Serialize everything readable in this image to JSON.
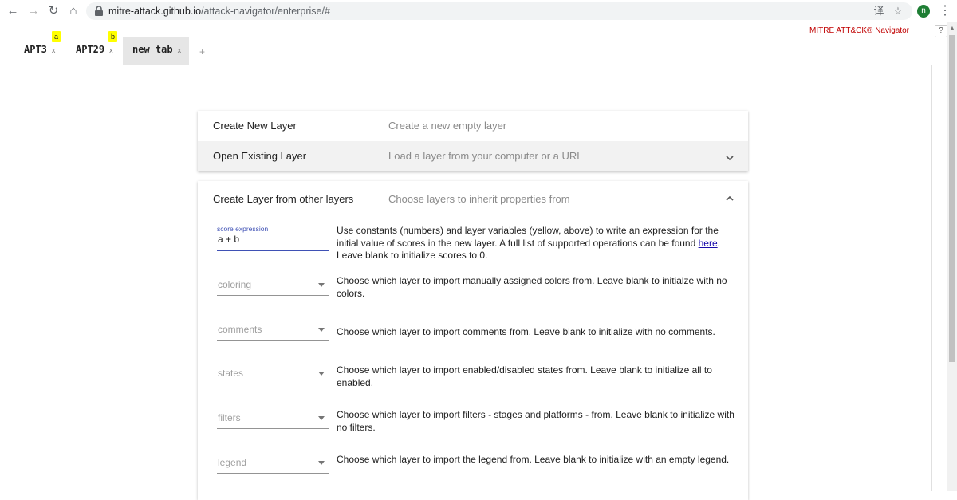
{
  "browser": {
    "url_host": "mitre-attack.github.io",
    "url_path": "/attack-navigator/enterprise/#",
    "profile_initial": "n"
  },
  "app": {
    "brand": "MITRE ATT&CK® Navigator",
    "help_label": "?",
    "tabs": [
      {
        "label": "APT3",
        "close": "x",
        "variable": "a"
      },
      {
        "label": "APT29",
        "close": "x",
        "variable": "b"
      },
      {
        "label": "new tab",
        "close": "x"
      }
    ],
    "add_tab_label": "+"
  },
  "panels": {
    "create_new": {
      "title": "Create New Layer",
      "desc": "Create a new empty layer"
    },
    "open_existing": {
      "title": "Open Existing Layer",
      "desc": "Load a layer from your computer or a URL"
    },
    "from_other": {
      "title": "Create Layer from other layers",
      "desc": "Choose layers to inherit properties from",
      "score": {
        "label": "score expression",
        "value": "a + b",
        "help_before": "Use constants (numbers) and layer variables (yellow, above) to write an expression for the initial value of scores in the new layer. A full list of supported operations can be found ",
        "help_link": "here",
        "help_after": ". Leave blank to initialize scores to 0."
      },
      "fields": [
        {
          "placeholder": "coloring",
          "help": "Choose which layer to import manually assigned colors from. Leave blank to initialze with no colors."
        },
        {
          "placeholder": "comments",
          "help": "Choose which layer to import comments from. Leave blank to initialize with no comments."
        },
        {
          "placeholder": "states",
          "help": "Choose which layer to import enabled/disabled states from. Leave blank to initialize all to enabled."
        },
        {
          "placeholder": "filters",
          "help": "Choose which layer to import filters - stages and platforms - from. Leave blank to initialize with no filters."
        },
        {
          "placeholder": "legend",
          "help": "Choose which layer to import the legend from. Leave blank to initialize with an empty legend."
        }
      ]
    }
  },
  "colors": {
    "accent": "#3f51b5",
    "brand": "#c00000",
    "variable_badge": "#ffff00"
  }
}
